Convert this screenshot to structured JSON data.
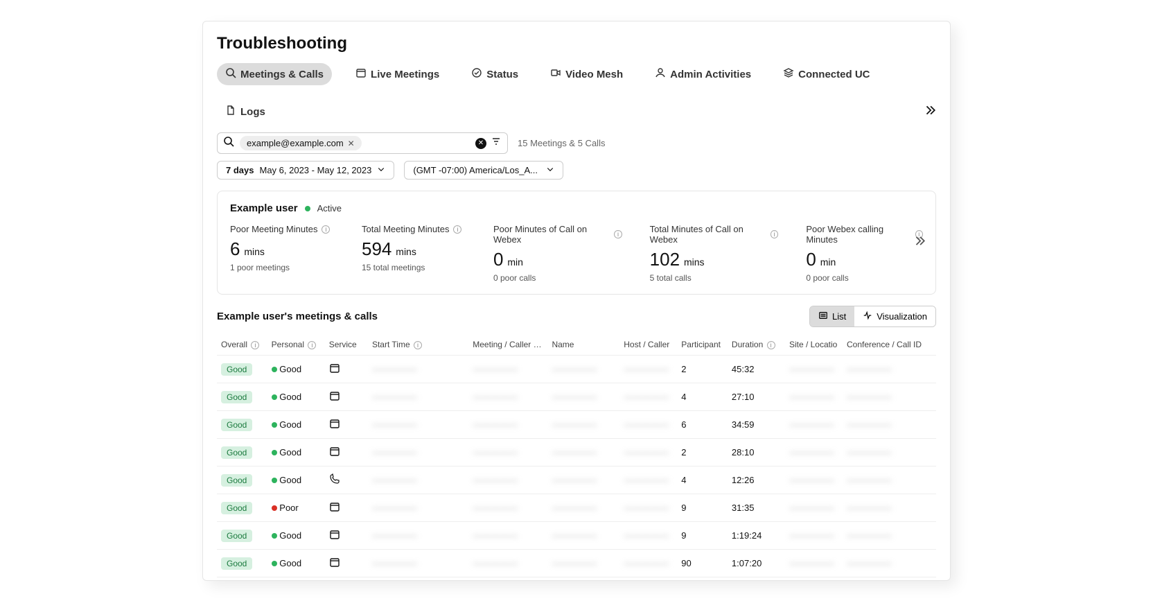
{
  "pageTitle": "Troubleshooting",
  "tabs": [
    {
      "label": "Meetings & Calls",
      "icon": "search",
      "active": true
    },
    {
      "label": "Live Meetings",
      "icon": "calendar"
    },
    {
      "label": "Status",
      "icon": "check-circle"
    },
    {
      "label": "Video Mesh",
      "icon": "video"
    },
    {
      "label": "Admin Activities",
      "icon": "user"
    },
    {
      "label": "Connected UC",
      "icon": "stack"
    },
    {
      "label": "Logs",
      "icon": "file"
    }
  ],
  "search": {
    "chip": "example@example.com",
    "results": "15 Meetings & 5 Calls"
  },
  "dateRange": {
    "prefix": "7 days",
    "range": "May 6, 2023 - May 12, 2023"
  },
  "timezone": "(GMT -07:00) America/Los_A...",
  "user": {
    "name": "Example user",
    "status": "Active"
  },
  "metrics": [
    {
      "label": "Poor Meeting Minutes",
      "value": "6",
      "unit": "mins",
      "sub": "1 poor meetings"
    },
    {
      "label": "Total Meeting Minutes",
      "value": "594",
      "unit": "mins",
      "sub": "15 total meetings"
    },
    {
      "label": "Poor Minutes of Call on Webex",
      "value": "0",
      "unit": "min",
      "sub": "0 poor calls"
    },
    {
      "label": "Total Minutes of Call on Webex",
      "value": "102",
      "unit": "mins",
      "sub": "5 total calls"
    },
    {
      "label": "Poor Webex calling Minutes",
      "value": "0",
      "unit": "min",
      "sub": "0 poor calls"
    }
  ],
  "tableTitle": "Example user's meetings & calls",
  "viewToggle": {
    "list": "List",
    "viz": "Visualization"
  },
  "columns": [
    "Overall",
    "Personal",
    "Service",
    "Start Time",
    "Meeting / Caller num",
    "Name",
    "Host / Caller",
    "Participant",
    "Duration",
    "Site / Locatio",
    "Conference / Call ID"
  ],
  "rows": [
    {
      "overall": "Good",
      "personal": "Good",
      "pStatus": "good",
      "service": "calendar",
      "participants": "2",
      "duration": "45:32"
    },
    {
      "overall": "Good",
      "personal": "Good",
      "pStatus": "good",
      "service": "calendar",
      "participants": "4",
      "duration": "27:10"
    },
    {
      "overall": "Good",
      "personal": "Good",
      "pStatus": "good",
      "service": "calendar",
      "participants": "6",
      "duration": "34:59"
    },
    {
      "overall": "Good",
      "personal": "Good",
      "pStatus": "good",
      "service": "calendar",
      "participants": "2",
      "duration": "28:10"
    },
    {
      "overall": "Good",
      "personal": "Good",
      "pStatus": "good",
      "service": "phone",
      "participants": "4",
      "duration": "12:26"
    },
    {
      "overall": "Good",
      "personal": "Poor",
      "pStatus": "poor",
      "service": "calendar",
      "participants": "9",
      "duration": "31:35"
    },
    {
      "overall": "Good",
      "personal": "Good",
      "pStatus": "good",
      "service": "calendar",
      "participants": "9",
      "duration": "1:19:24"
    },
    {
      "overall": "Good",
      "personal": "Good",
      "pStatus": "good",
      "service": "calendar",
      "participants": "90",
      "duration": "1:07:20"
    }
  ],
  "redacted": "—————"
}
